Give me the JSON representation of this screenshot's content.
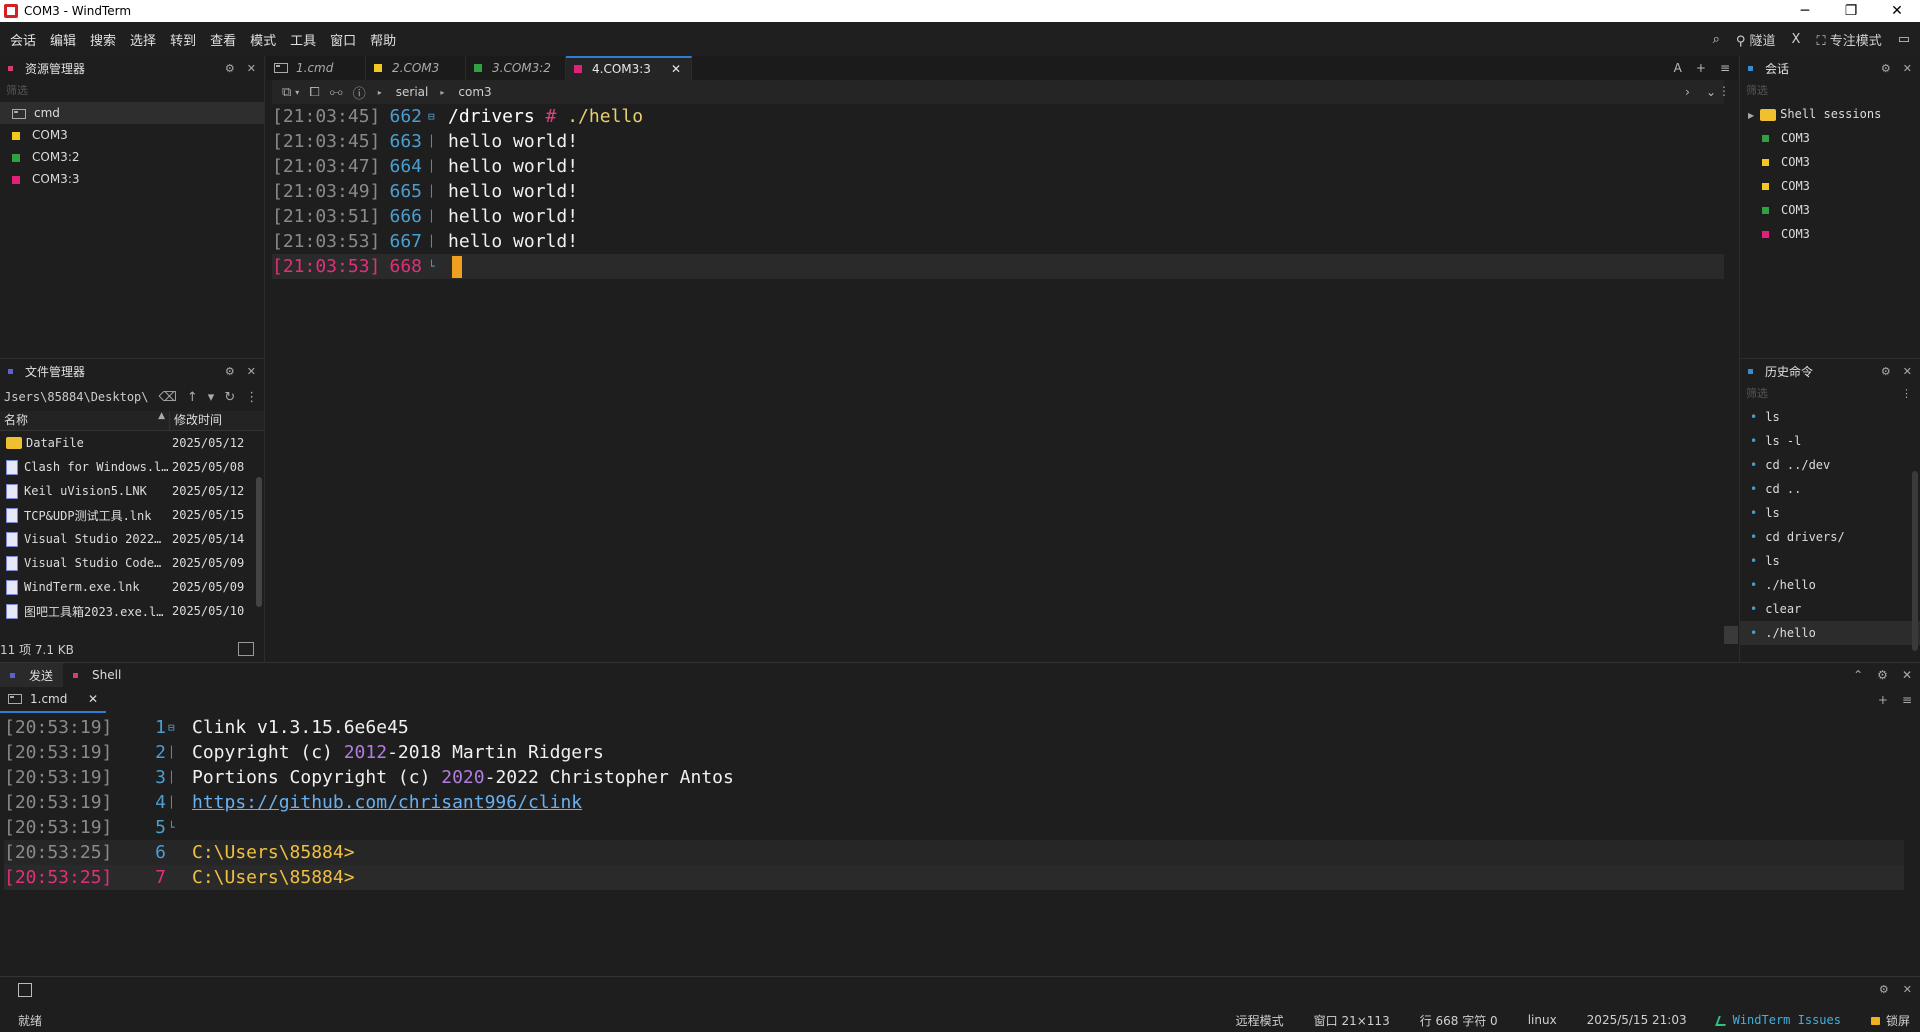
{
  "window": {
    "title": "COM3 - WindTerm",
    "minimize": "─",
    "maximize": "❐",
    "close": "✕"
  },
  "menu": {
    "items": [
      "会话",
      "编辑",
      "搜索",
      "选择",
      "转到",
      "查看",
      "模式",
      "工具",
      "窗口",
      "帮助"
    ],
    "tunnel": "隧道",
    "x": "X",
    "focus_mode": "专注模式"
  },
  "explorer": {
    "title": "资源管理器",
    "filter_placeholder": "筛选",
    "items": [
      {
        "label": "cmd",
        "color": ""
      },
      {
        "label": "COM3",
        "color": "#f0c820"
      },
      {
        "label": "COM3:2",
        "color": "#30a040"
      },
      {
        "label": "COM3:3",
        "color": "#e0207a"
      }
    ]
  },
  "filemgr": {
    "title": "文件管理器",
    "path": "Jsers\\85884\\Desktop\\",
    "col_name": "名称",
    "col_modified": "修改时间",
    "files": [
      {
        "name": "DataFile",
        "date": "2025/05/12 ",
        "type": "folder"
      },
      {
        "name": "Clash for Windows.l…",
        "date": "2025/05/08 ",
        "type": "file"
      },
      {
        "name": "Keil uVision5.LNK",
        "date": "2025/05/12 ",
        "type": "file"
      },
      {
        "name": "TCP&UDP测试工具.lnk",
        "date": "2025/05/15 ",
        "type": "file"
      },
      {
        "name": "Visual Studio 2022…",
        "date": "2025/05/14 ",
        "type": "file"
      },
      {
        "name": "Visual Studio Code…",
        "date": "2025/05/09 ",
        "type": "file"
      },
      {
        "name": "WindTerm.exe.lnk",
        "date": "2025/05/09 (",
        "type": "file"
      },
      {
        "name": "图吧工具箱2023.exe.l…",
        "date": "2025/05/10 ",
        "type": "file"
      }
    ],
    "footer": "11 项 7.1 KB"
  },
  "tabs": [
    {
      "label": "1.cmd",
      "color": "",
      "active": false
    },
    {
      "label": "2.COM3",
      "color": "#f0c820",
      "active": false
    },
    {
      "label": "3.COM3:2",
      "color": "#30a040",
      "active": false
    },
    {
      "label": "4.COM3:3",
      "color": "#e0207a",
      "active": true
    }
  ],
  "tabs_right": {
    "font": "A",
    "add": "+",
    "menu": "≡"
  },
  "toolbar": {
    "crumb1": "serial",
    "crumb2": "com3"
  },
  "terminal": {
    "lines": [
      {
        "ts": "[21:03:45]",
        "ln": "662",
        "path": "/drivers",
        "hash": " # ",
        "cmd": "./hello"
      },
      {
        "ts": "[21:03:45]",
        "ln": "663",
        "text": "hello world!"
      },
      {
        "ts": "[21:03:47]",
        "ln": "664",
        "text": "hello world!"
      },
      {
        "ts": "[21:03:49]",
        "ln": "665",
        "text": "hello world!"
      },
      {
        "ts": "[21:03:51]",
        "ln": "666",
        "text": "hello world!"
      },
      {
        "ts": "[21:03:53]",
        "ln": "667",
        "text": "hello world!"
      },
      {
        "ts": "[21:03:53]",
        "ln": "668",
        "text": ""
      }
    ]
  },
  "sessions": {
    "title": "会话",
    "filter_placeholder": "筛选",
    "group": "Shell sessions",
    "items": [
      {
        "label": "COM3",
        "color": "#30a040"
      },
      {
        "label": "COM3",
        "color": "#f0c820"
      },
      {
        "label": "COM3",
        "color": "#f0c820"
      },
      {
        "label": "COM3",
        "color": "#30a040"
      },
      {
        "label": "COM3",
        "color": "#e0207a"
      }
    ]
  },
  "history": {
    "title": "历史命令",
    "filter_placeholder": "筛选",
    "items": [
      "ls",
      "ls -l",
      "cd ../dev",
      "cd ..",
      "ls",
      "cd drivers/",
      "ls",
      "./hello",
      "clear",
      "./hello"
    ]
  },
  "bottom": {
    "tab_send": "发送",
    "tab_shell": "Shell",
    "subtab": "1.cmd",
    "lines": [
      {
        "ts": "[20:53:19]",
        "ln": "1",
        "kind": "plain",
        "text": "Clink v1.3.15.6e6e45"
      },
      {
        "ts": "[20:53:19]",
        "ln": "2",
        "kind": "copy",
        "a": "Copyright (c) ",
        "y1": "2012",
        "b": "-2018 Martin Ridgers"
      },
      {
        "ts": "[20:53:19]",
        "ln": "3",
        "kind": "copy",
        "a": "Portions Copyright (c) ",
        "y1": "2020",
        "b": "-2022 Christopher Antos"
      },
      {
        "ts": "[20:53:19]",
        "ln": "4",
        "kind": "link",
        "text": "https://github.com/chrisant996/clink"
      },
      {
        "ts": "[20:53:19]",
        "ln": "5",
        "kind": "plain",
        "text": ""
      },
      {
        "ts": "[20:53:25]",
        "ln": "6",
        "kind": "prompt",
        "text": "C:\\Users\\85884>"
      },
      {
        "ts": "[20:53:25]",
        "ln": "7",
        "kind": "prompt",
        "text": "C:\\Users\\85884>"
      }
    ]
  },
  "status": {
    "ready": "就绪",
    "remote_mode": "远程模式",
    "window_size": "窗口 21×113",
    "position": "行 668 字符 0",
    "os": "linux",
    "datetime": "2025/5/15 21:03",
    "issues": "WindTerm Issues",
    "lock": "锁屏"
  }
}
